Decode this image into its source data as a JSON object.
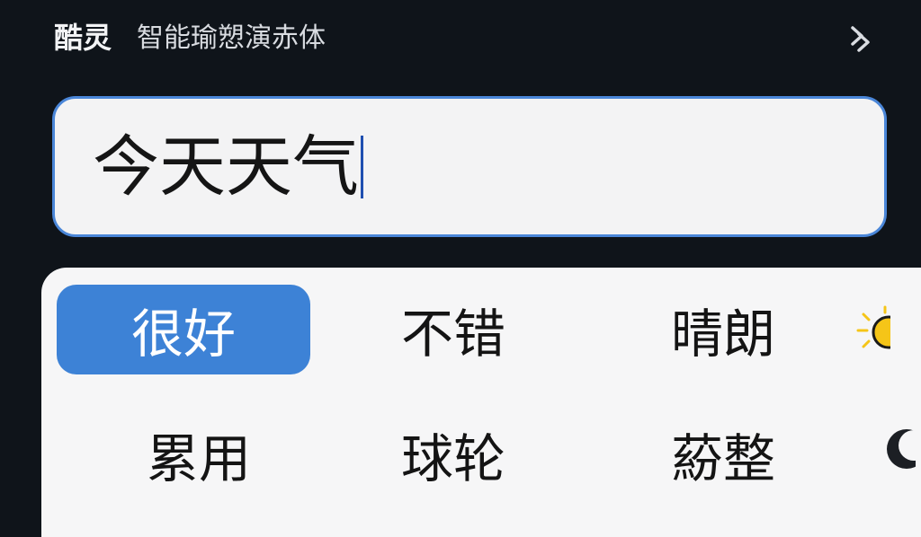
{
  "header": {
    "app_name": "酷灵",
    "subtitle": "智能瑜愬演赤体",
    "expand_icon": "double-chevron-right-icon"
  },
  "input": {
    "value": "今天天气"
  },
  "candidates": [
    {
      "label": "很好",
      "selected": true
    },
    {
      "label": "不错",
      "selected": false
    },
    {
      "label": "晴朗",
      "selected": false
    },
    {
      "label": "累用",
      "selected": false
    },
    {
      "label": "球轮",
      "selected": false
    },
    {
      "label": "蒶整",
      "selected": false
    }
  ],
  "icons": {
    "row1_trailing": "sun-icon",
    "row2_trailing": "moon-icon"
  },
  "colors": {
    "background": "#0f141a",
    "accent": "#3d82d6",
    "input_border": "#4a86d8",
    "panel": "#f6f6f7",
    "sun": "#f5c518"
  }
}
